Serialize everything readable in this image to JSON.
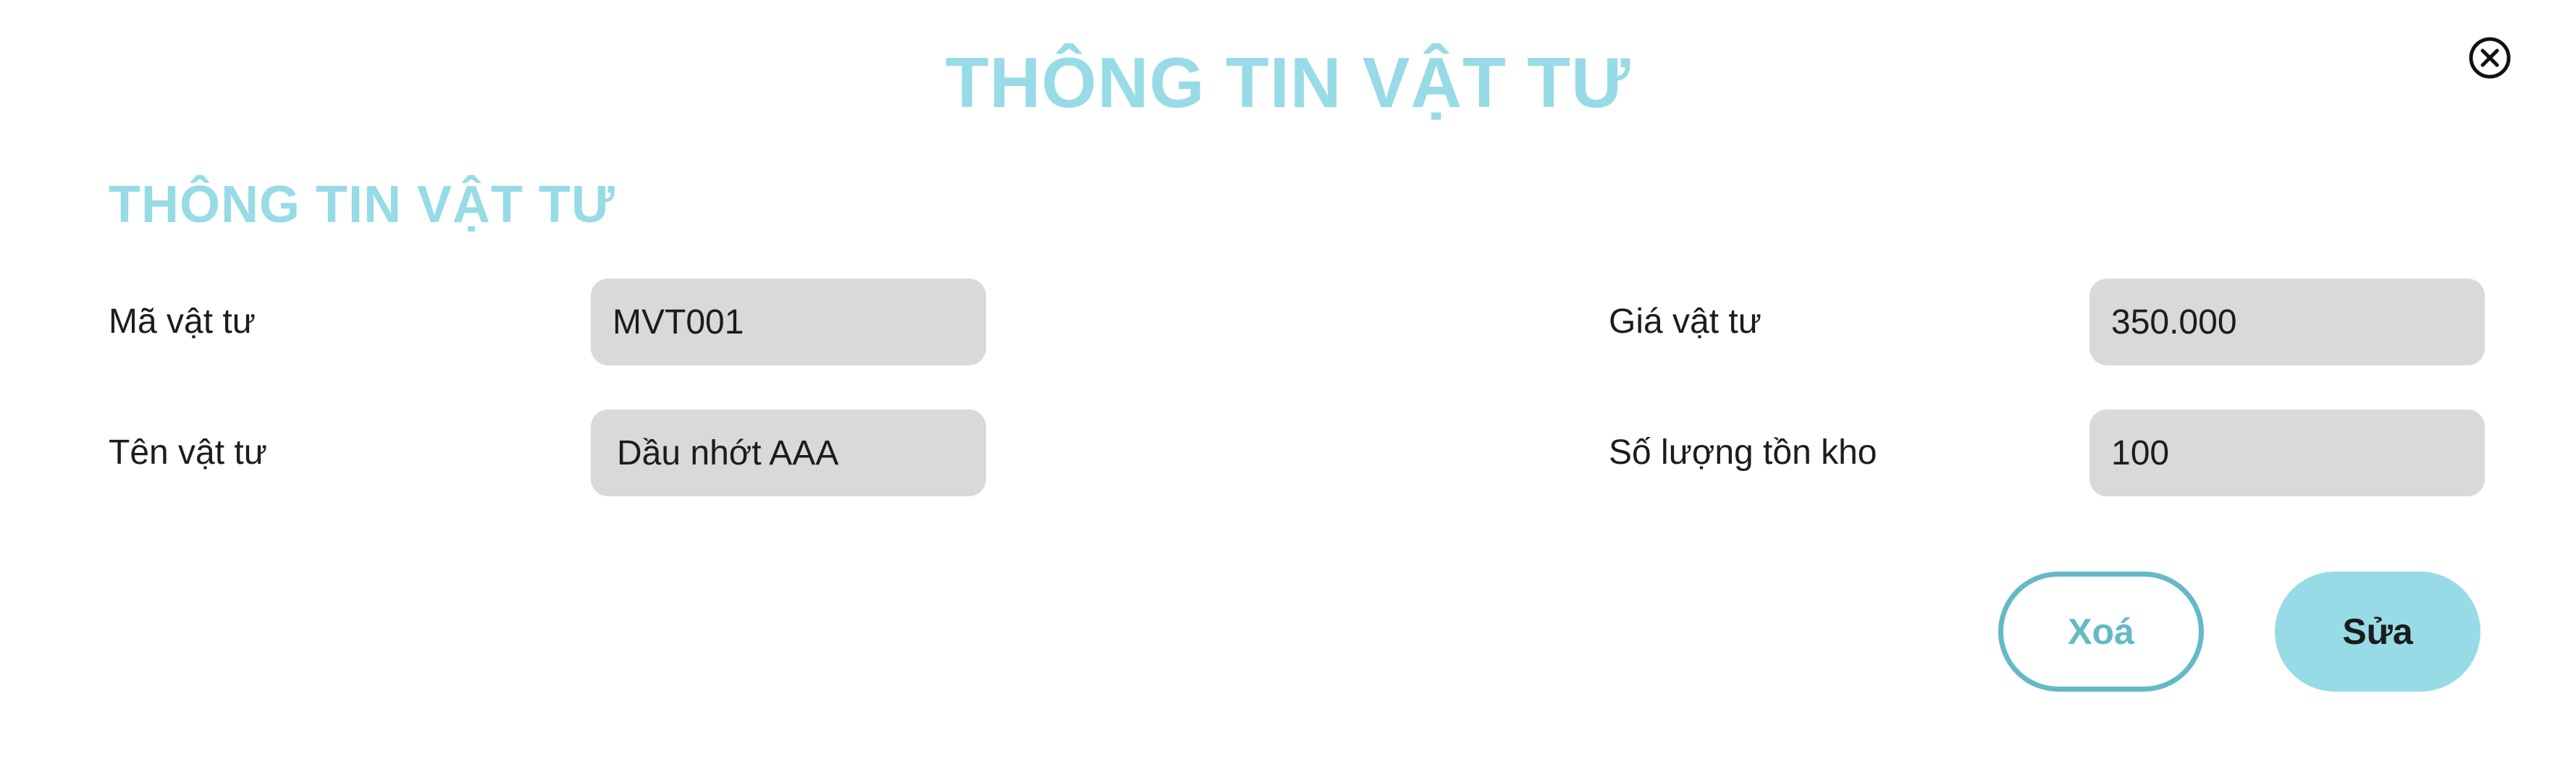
{
  "dialog": {
    "title": "THÔNG TIN VẬT TƯ",
    "close_icon": "close-circle-icon"
  },
  "section": {
    "title": "THÔNG TIN VẬT TƯ"
  },
  "fields": {
    "code": {
      "label": "Mã vật tư",
      "value": "MVT001"
    },
    "name": {
      "label": "Tên vật tư",
      "value": "Dầu nhớt AAA"
    },
    "price": {
      "label": "Giá vật tư",
      "value": "350.000"
    },
    "stock": {
      "label": "Số lượng tồn kho",
      "value": "100"
    }
  },
  "actions": {
    "delete_label": "Xoá",
    "edit_label": "Sửa"
  },
  "colors": {
    "accent": "#97dbe6",
    "accent_dark": "#65b9c6",
    "input_bg": "#d9d9d9",
    "text": "#1c1c1c"
  }
}
